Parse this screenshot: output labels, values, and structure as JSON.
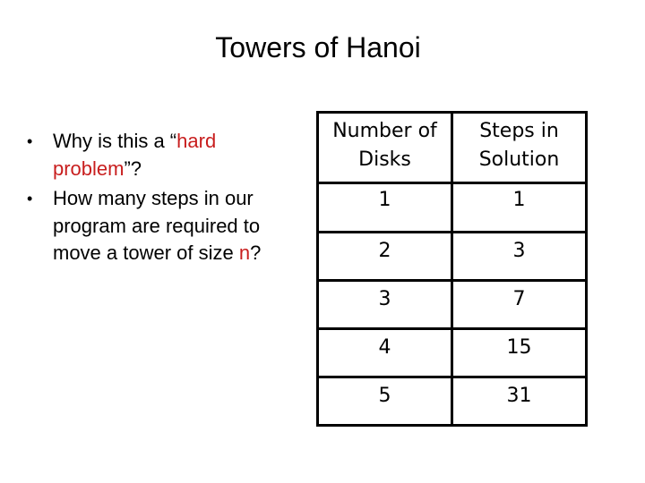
{
  "slide": {
    "title": "Towers of Hanoi",
    "bullets": [
      {
        "segments": [
          {
            "text": "Why is this a “",
            "emphasis": false
          },
          {
            "text": "hard problem",
            "emphasis": true
          },
          {
            "text": "”?",
            "emphasis": false
          }
        ]
      },
      {
        "segments": [
          {
            "text": "How many steps in our program are required to move a tower of size ",
            "emphasis": false
          },
          {
            "text": "n",
            "emphasis": true
          },
          {
            "text": "?",
            "emphasis": false
          }
        ]
      }
    ],
    "emphasis_color": "#c81e1e"
  },
  "table": {
    "headers": [
      "Number of Disks",
      "Steps in Solution"
    ],
    "rows": [
      [
        "1",
        "1"
      ],
      [
        "2",
        "3"
      ],
      [
        "3",
        "7"
      ],
      [
        "4",
        "15"
      ],
      [
        "5",
        "31"
      ]
    ]
  }
}
